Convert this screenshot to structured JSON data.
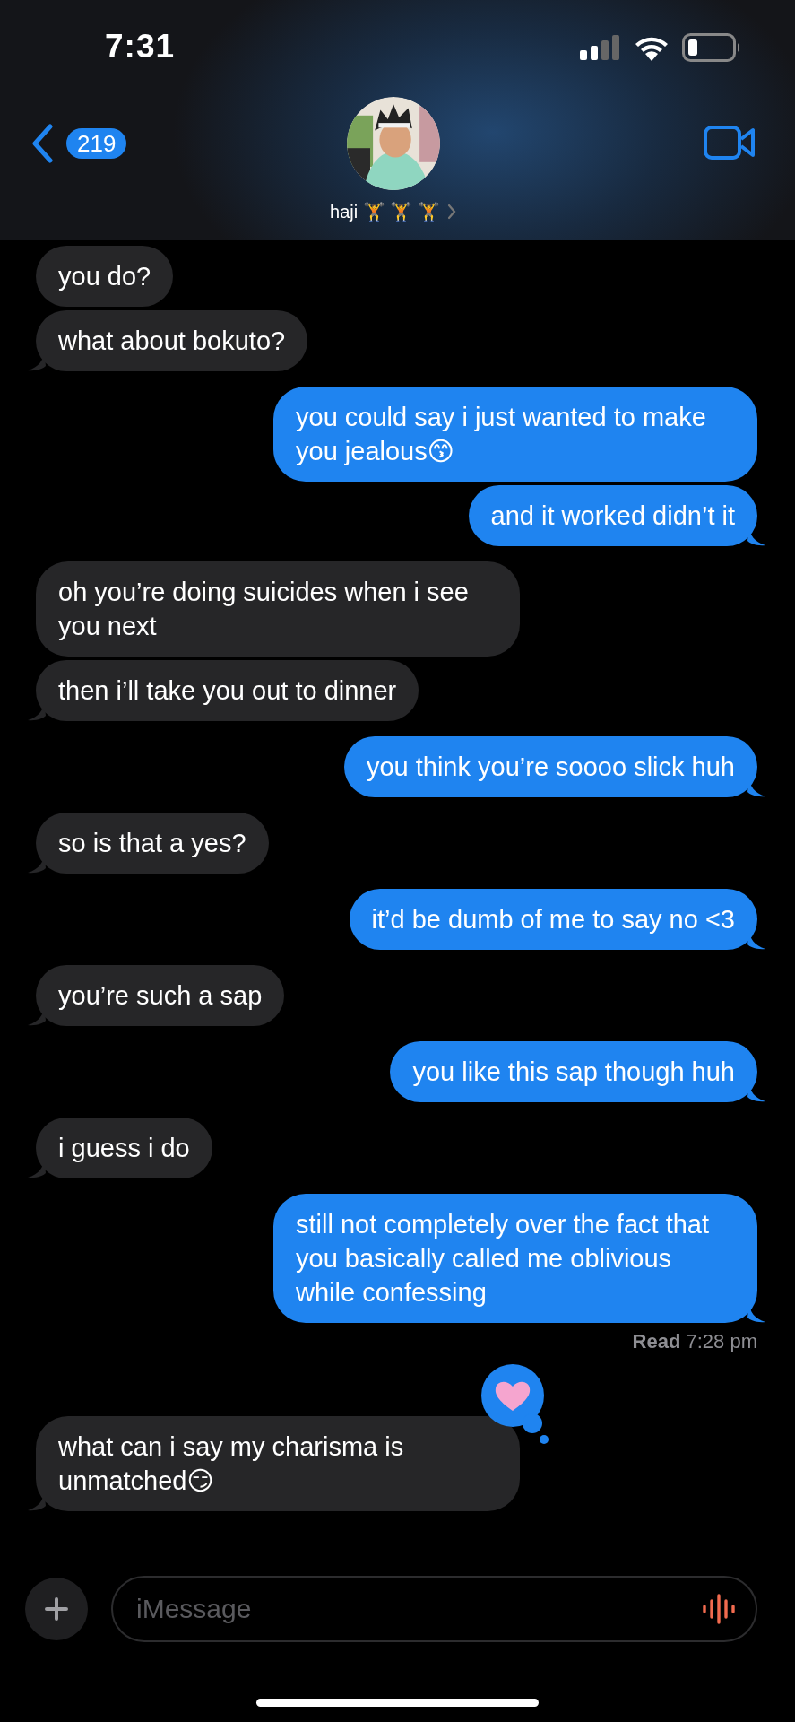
{
  "status_bar": {
    "time": "7:31"
  },
  "header": {
    "unread_count": "219",
    "contact_name": "haji 🏋️ 🏋️ 🏋️"
  },
  "messages": [
    {
      "kind": "received",
      "text": "you do?"
    },
    {
      "kind": "received",
      "text": "what about bokuto?"
    },
    {
      "kind": "sent",
      "text": "you could say i just wanted to make you jealous😙"
    },
    {
      "kind": "sent",
      "text": "and it worked didn’t it"
    },
    {
      "kind": "received",
      "text": "oh you’re doing suicides when i see you next"
    },
    {
      "kind": "received",
      "text": "then i’ll take you out to dinner"
    },
    {
      "kind": "sent",
      "text": "you think you’re soooo slick huh"
    },
    {
      "kind": "received",
      "text": "so is that a yes?"
    },
    {
      "kind": "sent",
      "text": "it’d be dumb of me to say no <3"
    },
    {
      "kind": "received",
      "text": "you’re such a sap"
    },
    {
      "kind": "sent",
      "text": "you like this sap though huh"
    },
    {
      "kind": "received",
      "text": "i guess i do"
    },
    {
      "kind": "sent",
      "text": "still not completely over the fact that you basically called me oblivious while confessing",
      "receipt": "**Read** 7:28 pm"
    },
    {
      "kind": "received",
      "text": "what can i say my charisma is unmatched😏",
      "reaction": {
        "kind": "heart"
      }
    }
  ],
  "composer": {
    "placeholder": "iMessage"
  }
}
